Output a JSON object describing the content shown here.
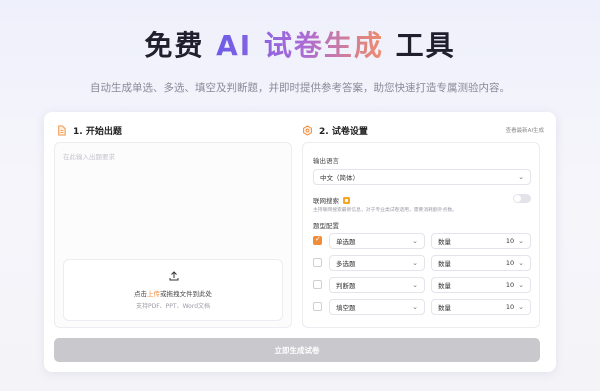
{
  "hero": {
    "title_pre": "免费 ",
    "title_hl": "AI 试卷生成",
    "title_post": " 工具",
    "subtitle": "自动生成单选、多选、填空及判断题，并即时提供参考答案，助您快速打造专属测验内容。"
  },
  "left": {
    "heading": "1. 开始出题",
    "placeholder": "在此输入出题要求",
    "upload": {
      "pre": "点击",
      "link": "上传",
      "post": "或拖拽文件到此处",
      "hint": "支持PDF、PPT、Word文档"
    }
  },
  "right": {
    "heading": "2. 试卷设置",
    "history_link": "查看最新AI生成",
    "output_lang_label": "输出语言",
    "output_lang_value": "中文（简体）",
    "web_search_label": "联网搜索",
    "web_search_desc": "主持联网搜索最新信息，对于专业类试卷适用，需要消耗额外点数。",
    "web_search_enabled": false,
    "question_types_label": "题型配置",
    "count_label": "数量",
    "question_types": [
      {
        "name": "单选题",
        "count": "10",
        "checked": true
      },
      {
        "name": "多选题",
        "count": "10",
        "checked": false
      },
      {
        "name": "判断题",
        "count": "10",
        "checked": false
      },
      {
        "name": "填空题",
        "count": "10",
        "checked": false
      }
    ]
  },
  "submit_label": "立即生成试卷",
  "colors": {
    "accent": "#ef8d3a",
    "gradient_start": "#6c5ce7",
    "gradient_end": "#ef8d6a",
    "button_disabled": "#c8c8cd"
  }
}
